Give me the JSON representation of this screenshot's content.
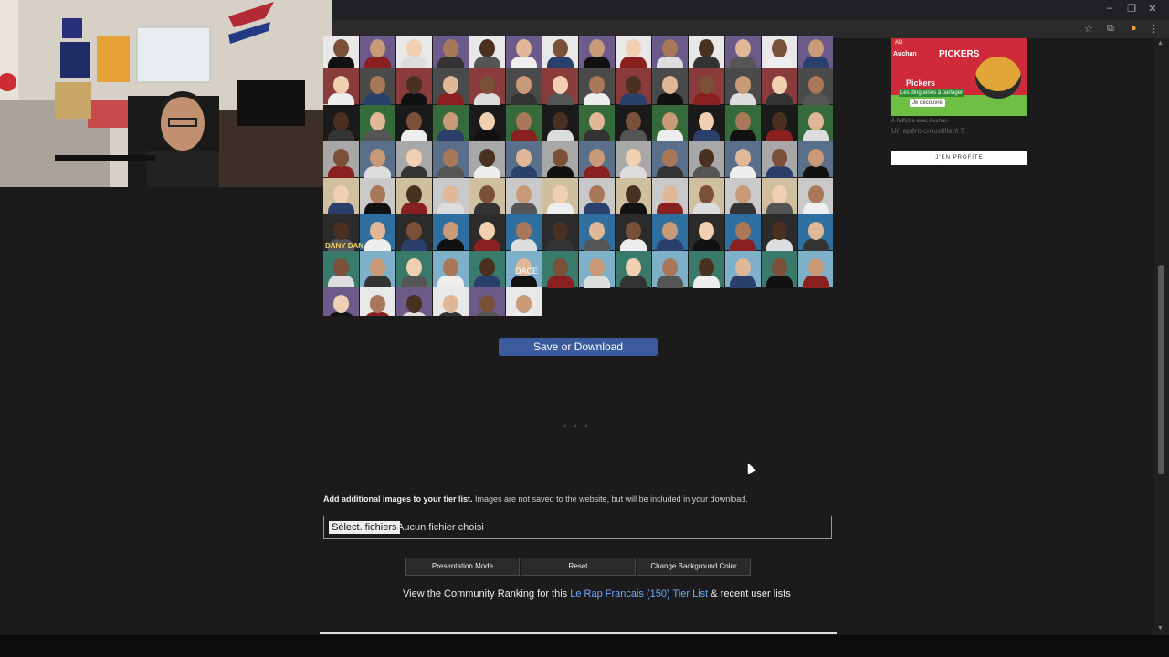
{
  "browser": {
    "window_controls": [
      "–",
      "❐",
      "✕"
    ]
  },
  "tierlist": {
    "save_button": "Save or Download",
    "loading_dots": "• • •",
    "add_images_bold": "Add additional images to your tier list.",
    "add_images_note": " Images are not saved to the website, but will be included in your download.",
    "file_button": "Sélect. fichiers",
    "file_status": "Aucun fichier choisi",
    "buttons": {
      "presentation": "Presentation Mode",
      "reset": "Reset",
      "background": "Change Background Color"
    },
    "community_prefix": "View the Community Ranking for this ",
    "community_link": "Le Rap Francais (150) Tier List",
    "community_suffix": " & recent user lists",
    "tile_labels": {
      "dany": "DANY DAN",
      "dace": "DACE"
    }
  },
  "ad": {
    "label": "AD",
    "brand": "Auchan",
    "product": "PICKERS",
    "title": "Pickers",
    "tagline": "Les dingueries à partager",
    "small_cta": "Je découvre",
    "sponsor": "À l'affiche avec Auchan",
    "headline": "Un apéro croustillant ?",
    "cta": "J'EN PROFITE"
  }
}
